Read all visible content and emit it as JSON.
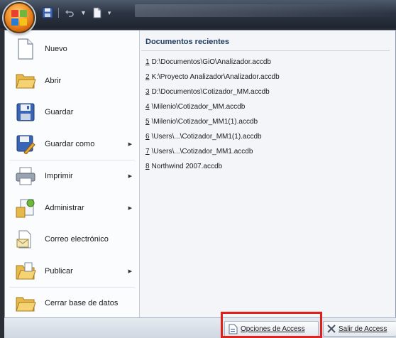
{
  "menu": {
    "commands": [
      {
        "name": "nuevo",
        "label": "Nuevo",
        "submenu": false
      },
      {
        "name": "abrir",
        "label": "Abrir",
        "submenu": false
      },
      {
        "name": "guardar",
        "label": "Guardar",
        "submenu": false
      },
      {
        "name": "guardar-como",
        "label": "Guardar como",
        "submenu": true
      },
      {
        "name": "imprimir",
        "label": "Imprimir",
        "submenu": true
      },
      {
        "name": "administrar",
        "label": "Administrar",
        "submenu": true
      },
      {
        "name": "correo",
        "label": "Correo electrónico",
        "submenu": false
      },
      {
        "name": "publicar",
        "label": "Publicar",
        "submenu": true
      },
      {
        "name": "cerrar",
        "label": "Cerrar base de datos",
        "submenu": false
      }
    ]
  },
  "recent": {
    "title": "Documentos recientes",
    "items": [
      {
        "num": "1",
        "path": "D:\\Documentos\\GiO\\Analizador.accdb"
      },
      {
        "num": "2",
        "path": "K:\\Proyecto Analizador\\Analizador.accdb"
      },
      {
        "num": "3",
        "path": "D:\\Documentos\\Cotizador_MM.accdb"
      },
      {
        "num": "4",
        "path": "\\Milenio\\Cotizador_MM.accdb"
      },
      {
        "num": "5",
        "path": "\\Milenio\\Cotizador_MM1(1).accdb"
      },
      {
        "num": "6",
        "path": "\\Users\\...\\Cotizador_MM1(1).accdb"
      },
      {
        "num": "7",
        "path": "\\Users\\...\\Cotizador_MM1.accdb"
      },
      {
        "num": "8",
        "path": "Northwind 2007.accdb"
      }
    ]
  },
  "footer": {
    "options_label": "Opciones de Access",
    "exit_label": "Salir de Access"
  },
  "colors": {
    "highlight": "#e0201a",
    "title_bar": "#2c3543",
    "orb": "#f5a03a"
  }
}
